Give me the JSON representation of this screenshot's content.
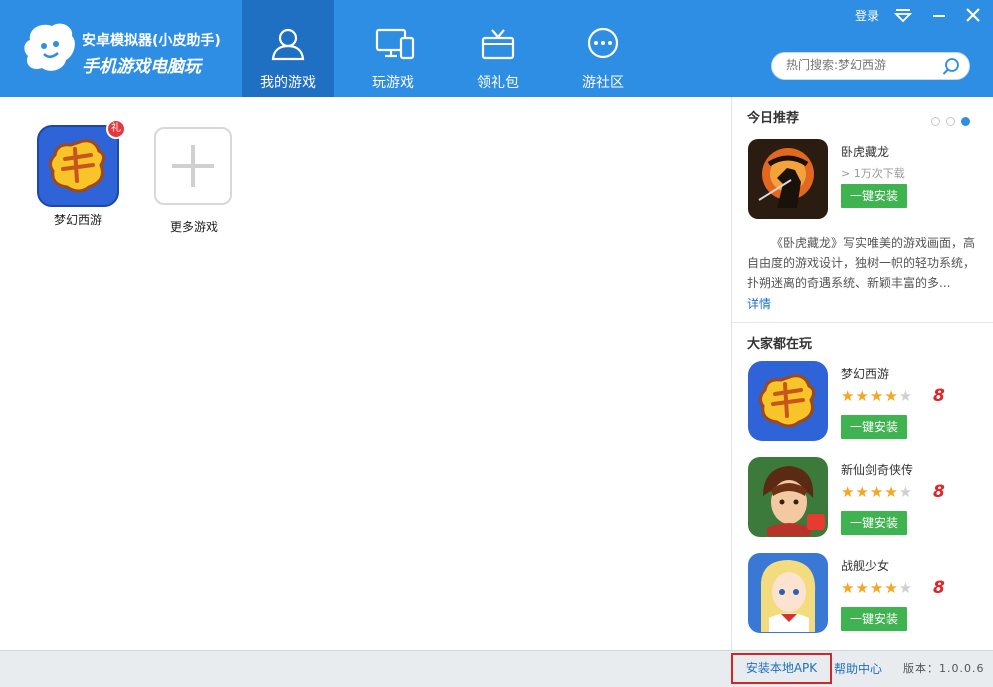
{
  "header": {
    "brand_title": "安卓模拟器(小皮助手)",
    "brand_slogan": "手机游戏电脑玩",
    "tabs": [
      {
        "label": "我的游戏",
        "icon": "person-icon",
        "active": true
      },
      {
        "label": "玩游戏",
        "icon": "devices-icon",
        "active": false
      },
      {
        "label": "领礼包",
        "icon": "gift-icon",
        "active": false
      },
      {
        "label": "游社区",
        "icon": "chat-icon",
        "active": false
      }
    ],
    "login_label": "登录",
    "search_placeholder": "热门搜索:梦幻西游",
    "accent_color": "#2d8ee3",
    "active_tab_color": "#1f6fc2"
  },
  "my_games": [
    {
      "name": "梦幻西游",
      "badge": "礼"
    },
    {
      "name": "更多游戏"
    }
  ],
  "today_pick": {
    "title": "今日推荐",
    "app_name": "卧虎藏龙",
    "downloads": "> 1万次下载",
    "install_label": "一键安装",
    "description": "《卧虎藏龙》写实唯美的游戏画面，高自由度的游戏设计，独树一帜的轻功系统，扑朔迷离的奇遇系统、新颖丰富的多...",
    "details_link": "详情"
  },
  "popular": {
    "title": "大家都在玩",
    "items": [
      {
        "name": "梦幻西游",
        "rating": 4,
        "score": "8",
        "install_label": "一键安装"
      },
      {
        "name": "新仙剑奇侠传",
        "rating": 4,
        "score": "8",
        "install_label": "一键安装"
      },
      {
        "name": "战舰少女",
        "rating": 4,
        "score": "8",
        "install_label": "一键安装"
      }
    ]
  },
  "footer": {
    "install_apk": "安装本地APK",
    "help": "帮助中心",
    "version_label": "版本：",
    "version": "1.0.0.6"
  }
}
